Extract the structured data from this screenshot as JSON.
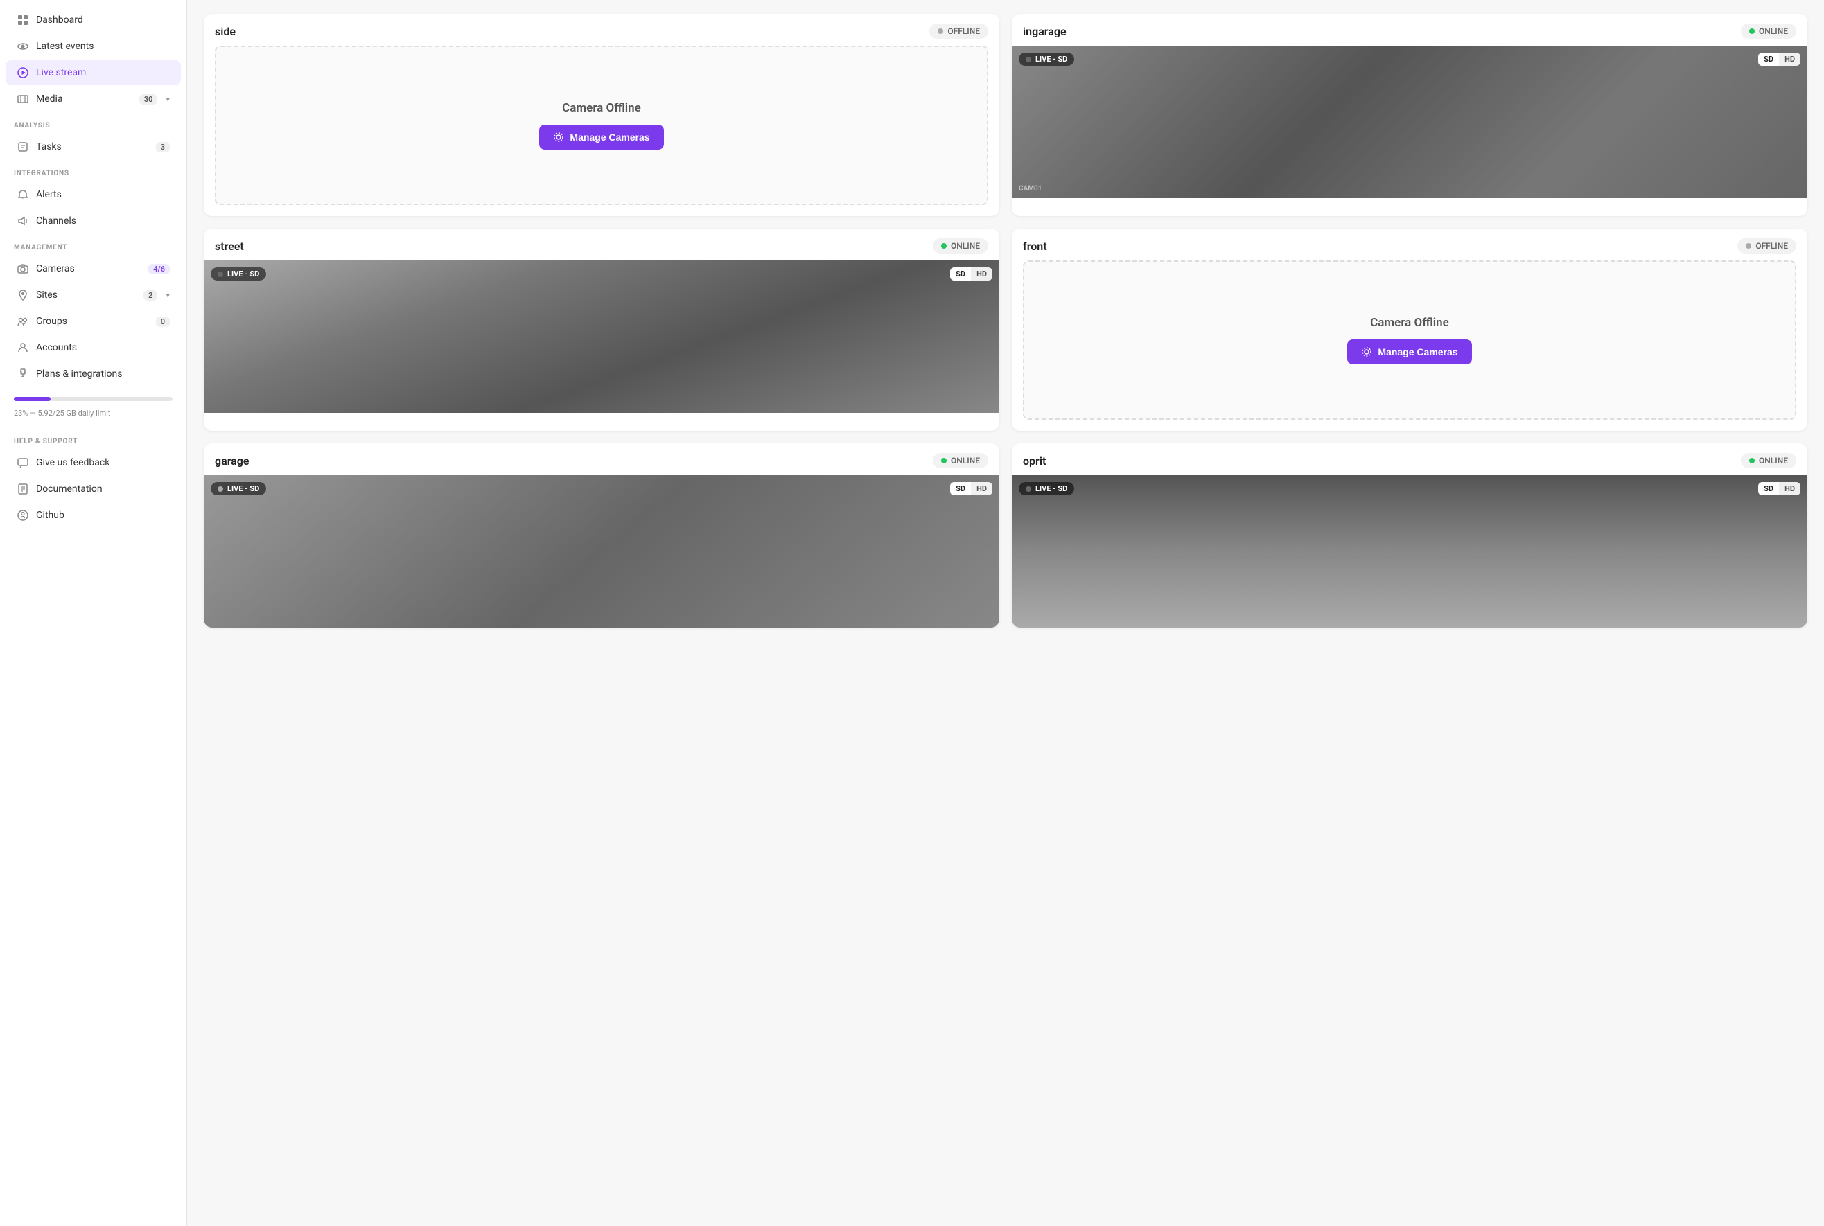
{
  "sidebar": {
    "nav": [
      {
        "id": "dashboard",
        "label": "Dashboard",
        "icon": "grid",
        "active": false,
        "badge": null
      },
      {
        "id": "latest-events",
        "label": "Latest events",
        "icon": "eye",
        "active": false,
        "badge": null
      },
      {
        "id": "live-stream",
        "label": "Live stream",
        "icon": "circle-play",
        "active": true,
        "badge": null
      },
      {
        "id": "media",
        "label": "Media",
        "icon": "film",
        "active": false,
        "badge": "30"
      }
    ],
    "analysis_label": "ANALYSIS",
    "analysis": [
      {
        "id": "tasks",
        "label": "Tasks",
        "icon": "tasks",
        "badge": "3"
      }
    ],
    "integrations_label": "INTEGRATIONS",
    "integrations": [
      {
        "id": "alerts",
        "label": "Alerts",
        "icon": "bell"
      },
      {
        "id": "channels",
        "label": "Channels",
        "icon": "megaphone"
      }
    ],
    "management_label": "MANAGEMENT",
    "management": [
      {
        "id": "cameras",
        "label": "Cameras",
        "icon": "camera",
        "badge": "4/6"
      },
      {
        "id": "sites",
        "label": "Sites",
        "icon": "pin",
        "badge": "2",
        "chevron": true
      },
      {
        "id": "groups",
        "label": "Groups",
        "icon": "groups",
        "badge": "0"
      },
      {
        "id": "accounts",
        "label": "Accounts",
        "icon": "person",
        "badge": null
      },
      {
        "id": "plans",
        "label": "Plans & integrations",
        "icon": "plug",
        "badge": null
      }
    ],
    "storage": {
      "percent": 23,
      "label": "23% — 5.92/25 GB daily limit"
    },
    "help_label": "HELP & SUPPORT",
    "help": [
      {
        "id": "feedback",
        "label": "Give us feedback",
        "icon": "comment"
      },
      {
        "id": "documentation",
        "label": "Documentation",
        "icon": "book"
      },
      {
        "id": "github",
        "label": "Github",
        "icon": "github"
      }
    ]
  },
  "cameras": [
    {
      "id": "side",
      "name": "side",
      "status": "OFFLINE",
      "online": false,
      "feed": "offline",
      "offline_text": "Camera Offline",
      "manage_label": "Manage Cameras"
    },
    {
      "id": "ingarage",
      "name": "ingarage",
      "status": "ONLINE",
      "online": true,
      "feed": "ingarage",
      "live_label": "LIVE - SD",
      "quality_sd": "SD",
      "quality_hd": "HD",
      "cam_label": "CAM01"
    },
    {
      "id": "street",
      "name": "street",
      "status": "ONLINE",
      "online": true,
      "feed": "street",
      "live_label": "LIVE - SD",
      "quality_sd": "SD",
      "quality_hd": "HD"
    },
    {
      "id": "front",
      "name": "front",
      "status": "OFFLINE",
      "online": false,
      "feed": "offline",
      "offline_text": "Camera Offline",
      "manage_label": "Manage Cameras"
    },
    {
      "id": "garage",
      "name": "garage",
      "status": "ONLINE",
      "online": true,
      "feed": "garage",
      "live_label": "LIVE - SD",
      "quality_sd": "SD",
      "quality_hd": "HD"
    },
    {
      "id": "oprit",
      "name": "oprit",
      "status": "ONLINE",
      "online": true,
      "feed": "oprit",
      "live_label": "LIVE - SD",
      "quality_sd": "SD",
      "quality_hd": "HD"
    }
  ]
}
